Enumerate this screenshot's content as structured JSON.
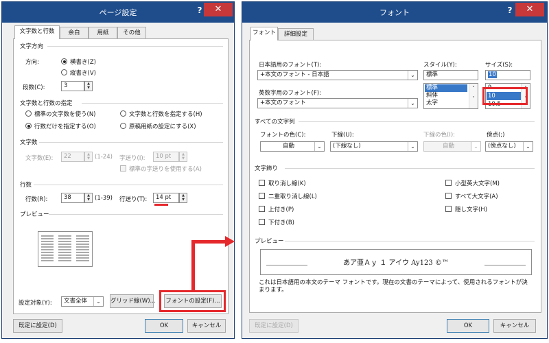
{
  "page_setup": {
    "title": "ページ設定",
    "help": "?",
    "close": "✕",
    "tabs": [
      "文字数と行数",
      "余白",
      "用紙",
      "その他"
    ],
    "text_direction": {
      "heading": "文字方向",
      "direction_label": "方向:",
      "option_horizontal": "横書き(Z)",
      "option_vertical": "縦書き(V)",
      "columns_label": "段数(C):",
      "columns_value": "3"
    },
    "grid": {
      "heading": "文字数と行数の指定",
      "opt_standard": "標準の文字数を使う(N)",
      "opt_chars_lines": "文字数と行数を指定する(H)",
      "opt_lines_only": "行数だけを指定する(O)",
      "opt_manuscript": "原稿用紙の設定にする(X)"
    },
    "chars": {
      "heading": "文字数",
      "count_label": "文字数(E):",
      "count_value": "22",
      "count_range": "(1-24)",
      "pitch_label": "字送り(I):",
      "pitch_value": "10 pt",
      "default_pitch": "標準の字送りを使用する(A)"
    },
    "lines": {
      "heading": "行数",
      "count_label": "行数(R):",
      "count_value": "38",
      "count_range": "(1-39)",
      "pitch_label": "行送り(T):",
      "pitch_value": "14 pt"
    },
    "preview_heading": "プレビュー",
    "apply_label": "設定対象(Y):",
    "apply_value": "文書全体",
    "grid_button": "グリッド線(W)...",
    "font_button": "フォントの設定(F)...",
    "default_button": "既定に設定(D)",
    "ok": "OK",
    "cancel": "キャンセル"
  },
  "font_dialog": {
    "title": "フォント",
    "help": "?",
    "close": "✕",
    "tabs": [
      "フォント",
      "詳細設定"
    ],
    "jp_font_label": "日本語用のフォント(T):",
    "jp_font_value": "+本文のフォント - 日本語",
    "en_font_label": "英数字用のフォント(F):",
    "en_font_value": "+本文のフォント",
    "style_label": "スタイル(Y):",
    "style_value": "標準",
    "style_options": [
      "標準",
      "斜体",
      "太字"
    ],
    "size_label": "サイズ(S):",
    "size_value": "10",
    "size_options": [
      "9",
      "10",
      "10.5"
    ],
    "all_text_heading": "すべての文字列",
    "color_label": "フォントの色(C):",
    "color_value": "自動",
    "underline_label": "下線(U):",
    "underline_value": "(下線なし)",
    "underline_color_label": "下線の色(I):",
    "underline_color_value": "自動",
    "emphasis_label": "傍点(;)",
    "emphasis_value": "(傍点なし)",
    "effects_heading": "文字飾り",
    "effects": {
      "strikethrough": "取り消し線(K)",
      "double_strike": "二重取り消し線(L)",
      "superscript": "上付き(P)",
      "subscript": "下付き(B)",
      "small_caps": "小型英大文字(M)",
      "all_caps": "すべて大文字(A)",
      "hidden": "隠し文字(H)"
    },
    "preview_heading": "プレビュー",
    "preview_sample": "あア亜Ａｙ １ アイウ Ay123 ©™",
    "description": "これは日本語用の本文のテーマ フォントです。現在の文書のテーマによって、使用されるフォントが決まります。",
    "default_button": "既定に設定(D)",
    "ok": "OK",
    "cancel": "キャンセル"
  },
  "colors": {
    "title_bar": "#1f4d8c",
    "close_button": "#c7383a",
    "highlight": "#e5282c",
    "selection": "#3878c8"
  }
}
